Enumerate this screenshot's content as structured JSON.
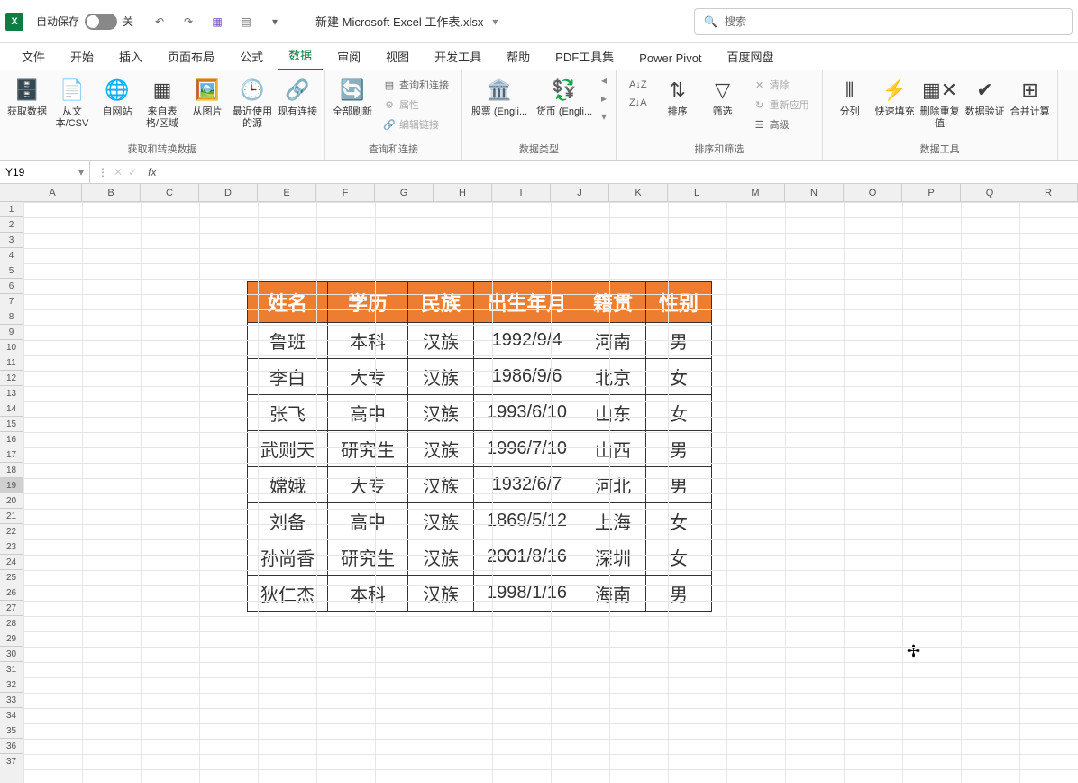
{
  "titlebar": {
    "autosave_label": "自动保存",
    "autosave_state": "关",
    "doc_title": "新建 Microsoft Excel 工作表.xlsx",
    "search_placeholder": "搜索"
  },
  "tabs": {
    "file": "文件",
    "home": "开始",
    "insert": "插入",
    "page_layout": "页面布局",
    "formulas": "公式",
    "data": "数据",
    "review": "审阅",
    "view": "视图",
    "developer": "开发工具",
    "help": "帮助",
    "pdf": "PDF工具集",
    "powerpivot": "Power Pivot",
    "baidu": "百度网盘"
  },
  "ribbon": {
    "group1_label": "获取和转换数据",
    "get_data": "获取数据",
    "from_text": "从文本/CSV",
    "from_web": "自网站",
    "from_table": "来自表格/区域",
    "from_pic": "从图片",
    "recent": "最近使用的源",
    "existing": "现有连接",
    "group2_label": "查询和连接",
    "refresh_all": "全部刷新",
    "queries": "查询和连接",
    "properties": "属性",
    "edit_links": "编辑链接",
    "group3_label": "数据类型",
    "stocks": "股票 (Engli...",
    "currency": "货币 (Engli...",
    "group4_label": "排序和筛选",
    "sort": "排序",
    "filter": "筛选",
    "clear": "清除",
    "reapply": "重新应用",
    "advanced": "高级",
    "group5_label": "数据工具",
    "text_to_col": "分列",
    "flash_fill": "快速填充",
    "remove_dup": "删除重复值",
    "data_val": "数据验证",
    "consolidate": "合并计算"
  },
  "namebox": {
    "ref": "Y19"
  },
  "columns": [
    "A",
    "B",
    "C",
    "D",
    "E",
    "F",
    "G",
    "H",
    "I",
    "J",
    "K",
    "L",
    "M",
    "N",
    "O",
    "P",
    "Q",
    "R"
  ],
  "table": {
    "headers": [
      "姓名",
      "学历",
      "民族",
      "出生年月",
      "籍贯",
      "性别"
    ],
    "rows": [
      [
        "鲁班",
        "本科",
        "汉族",
        "1992/9/4",
        "河南",
        "男"
      ],
      [
        "李白",
        "大专",
        "汉族",
        "1986/9/6",
        "北京",
        "女"
      ],
      [
        "张飞",
        "高中",
        "汉族",
        "1993/6/10",
        "山东",
        "女"
      ],
      [
        "武则天",
        "研究生",
        "汉族",
        "1996/7/10",
        "山西",
        "男"
      ],
      [
        "嫦娥",
        "大专",
        "汉族",
        "1932/6/7",
        "河北",
        "男"
      ],
      [
        "刘备",
        "高中",
        "汉族",
        "1869/5/12",
        "上海",
        "女"
      ],
      [
        "孙尚香",
        "研究生",
        "汉族",
        "2001/8/16",
        "深圳",
        "女"
      ],
      [
        "狄仁杰",
        "本科",
        "汉族",
        "1998/1/16",
        "海南",
        "男"
      ]
    ]
  }
}
